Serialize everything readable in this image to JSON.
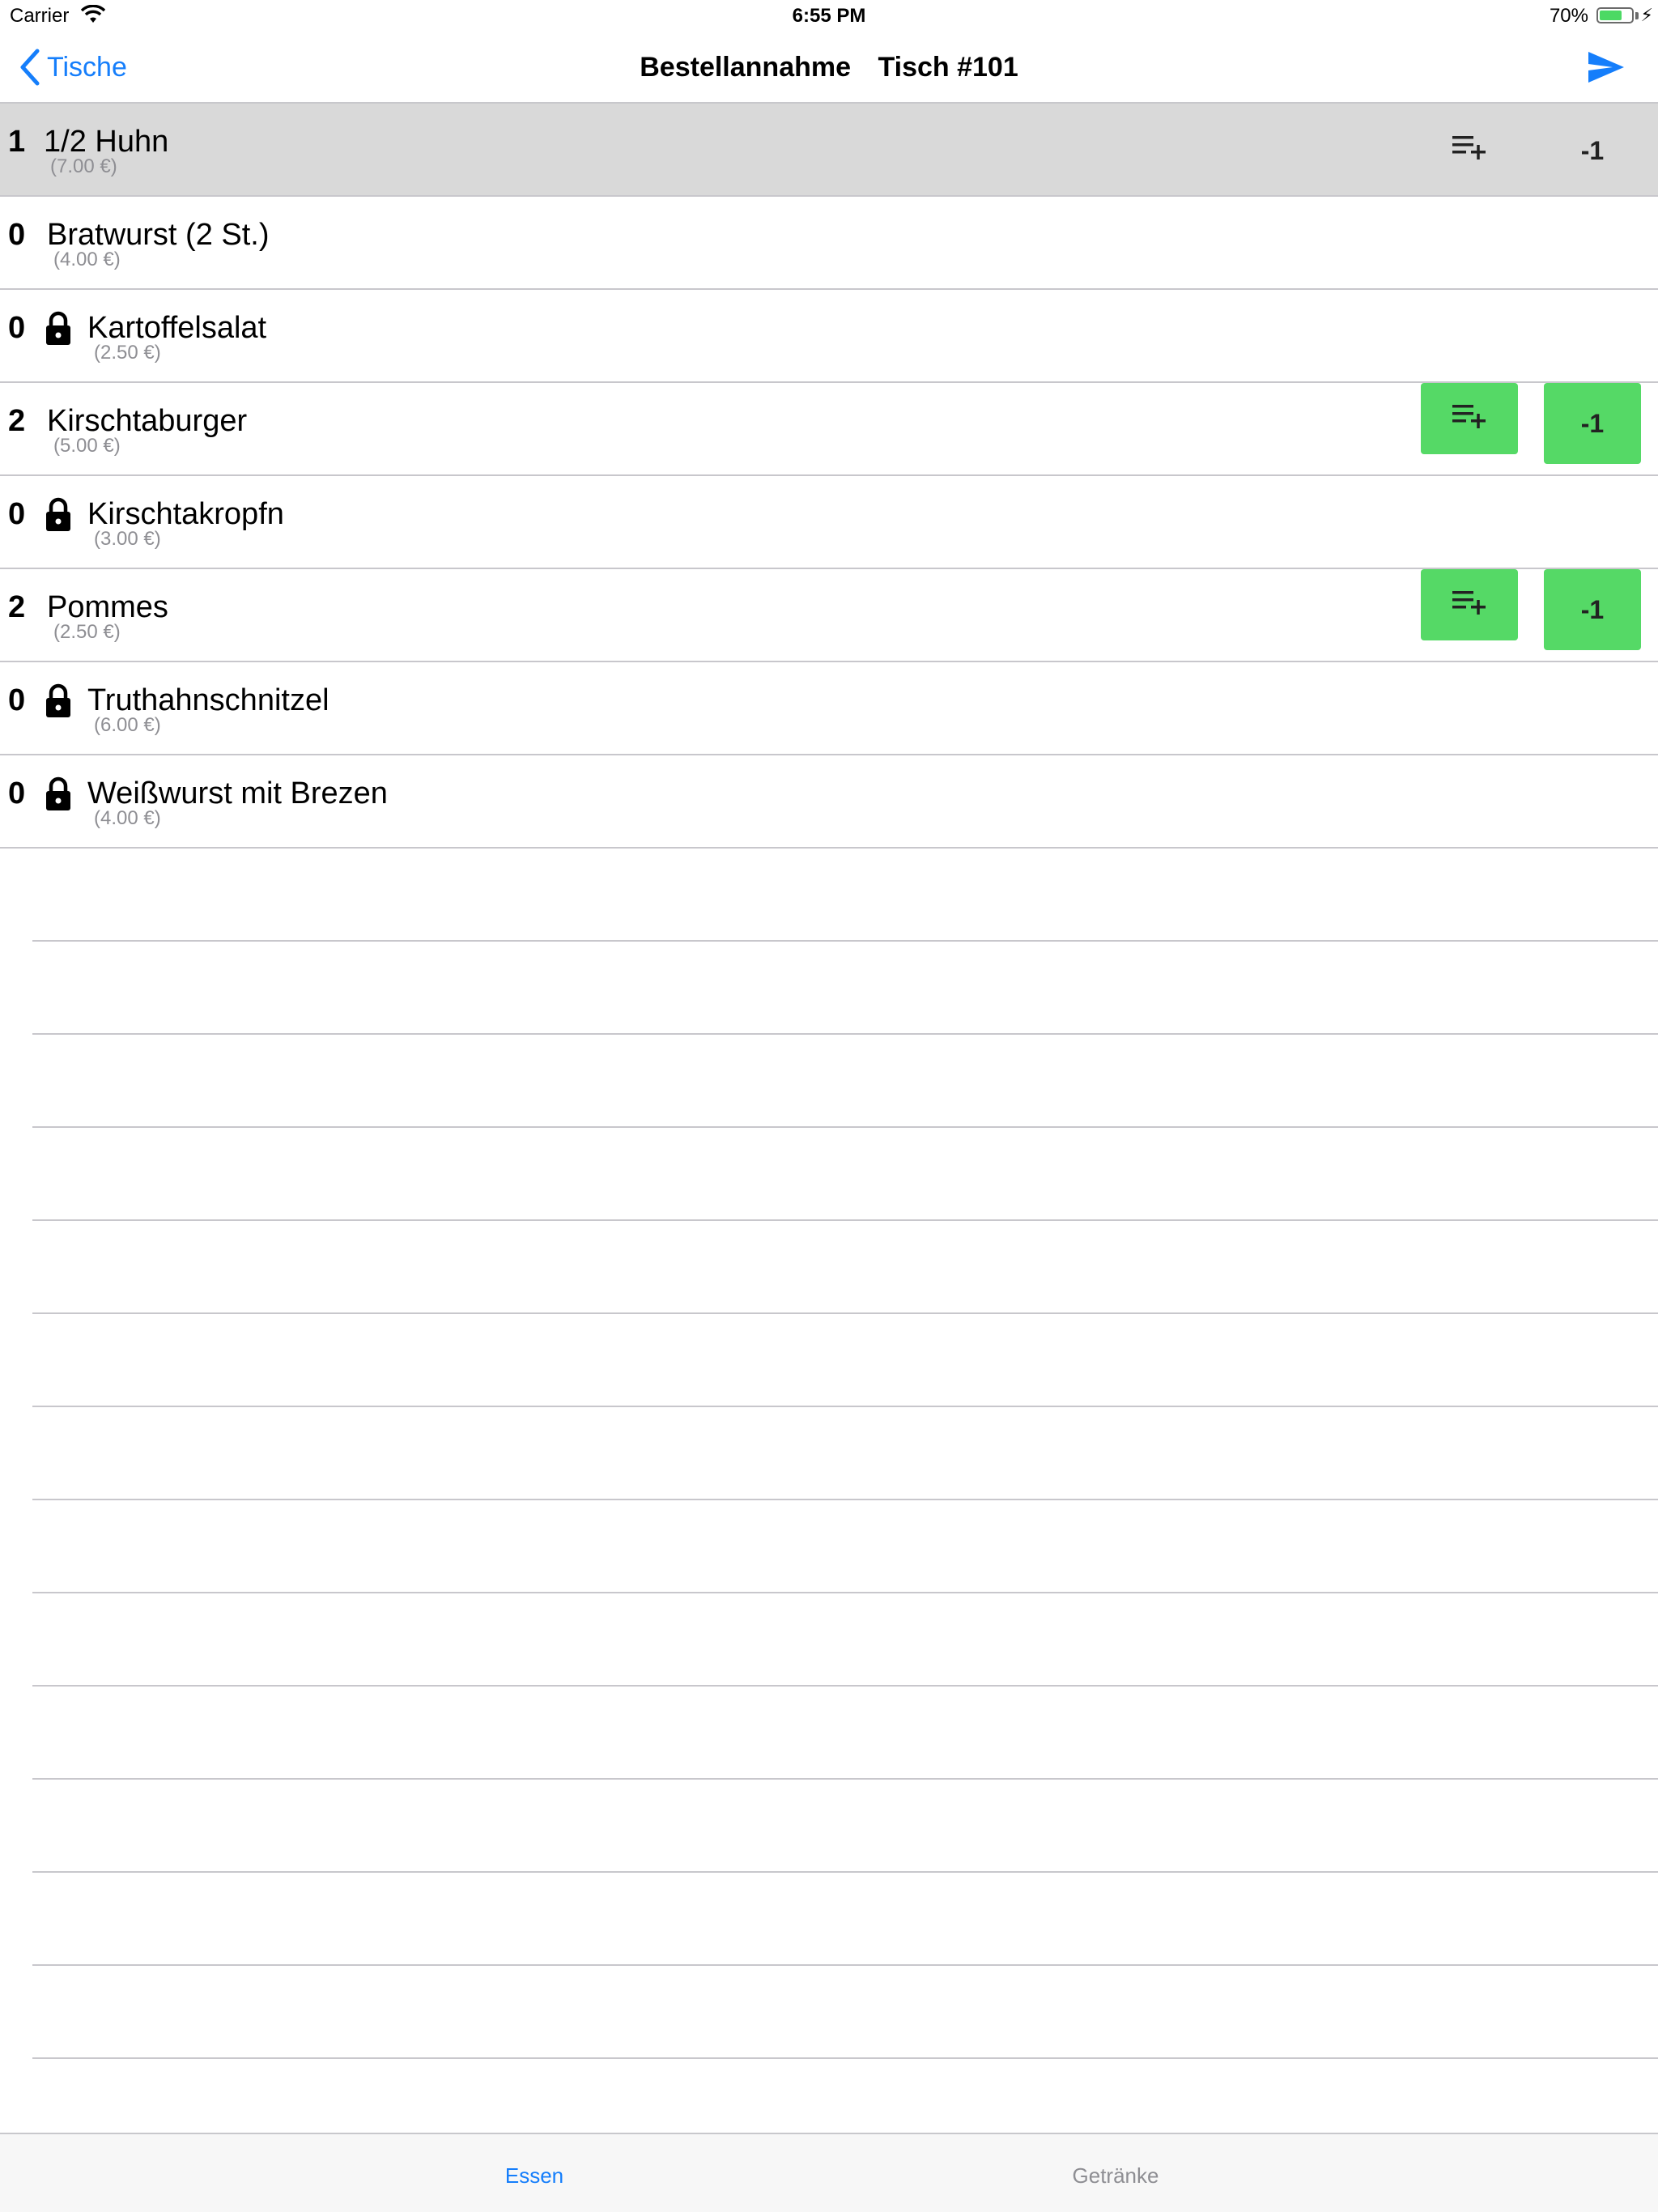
{
  "status_bar": {
    "carrier": "Carrier",
    "time": "6:55 PM",
    "battery_percent": "70%",
    "battery_level": 0.7,
    "battery_color": "#4cd964"
  },
  "nav": {
    "back_label": "Tische",
    "title": "Bestellannahme",
    "table": "Tisch #101",
    "send_icon": "paper-plane-icon",
    "accent_color": "#157efb"
  },
  "items": [
    {
      "count": "1",
      "name": "1/2 Huhn",
      "price": "(7.00 €)",
      "locked": false,
      "selected": true,
      "actions": "plain",
      "add_icon": "playlist-add-icon",
      "minus_label": "-1"
    },
    {
      "count": "0",
      "name": "Bratwurst (2 St.)",
      "price": "(4.00 €)",
      "locked": false,
      "selected": false,
      "actions": "none"
    },
    {
      "count": "0",
      "name": "Kartoffelsalat",
      "price": "(2.50 €)",
      "locked": true,
      "selected": false,
      "actions": "none"
    },
    {
      "count": "2",
      "name": "Kirschtaburger",
      "price": "(5.00 €)",
      "locked": false,
      "selected": false,
      "actions": "green",
      "add_icon": "playlist-add-icon",
      "minus_label": "-1"
    },
    {
      "count": "0",
      "name": "Kirschtakropfn",
      "price": "(3.00 €)",
      "locked": true,
      "selected": false,
      "actions": "none"
    },
    {
      "count": "2",
      "name": "Pommes",
      "price": "(2.50 €)",
      "locked": false,
      "selected": false,
      "actions": "green",
      "add_icon": "playlist-add-icon",
      "minus_label": "-1"
    },
    {
      "count": "0",
      "name": "Truthahnschnitzel",
      "price": "(6.00 €)",
      "locked": true,
      "selected": false,
      "actions": "none"
    },
    {
      "count": "0",
      "name": "Weißwurst mit Brezen",
      "price": "(4.00 €)",
      "locked": true,
      "selected": false,
      "actions": "none"
    }
  ],
  "action_button_color": "#55d966",
  "selected_row_color": "#d9d9d9",
  "tabs": [
    {
      "label": "Essen",
      "active": true
    },
    {
      "label": "Getränke",
      "active": false
    }
  ]
}
